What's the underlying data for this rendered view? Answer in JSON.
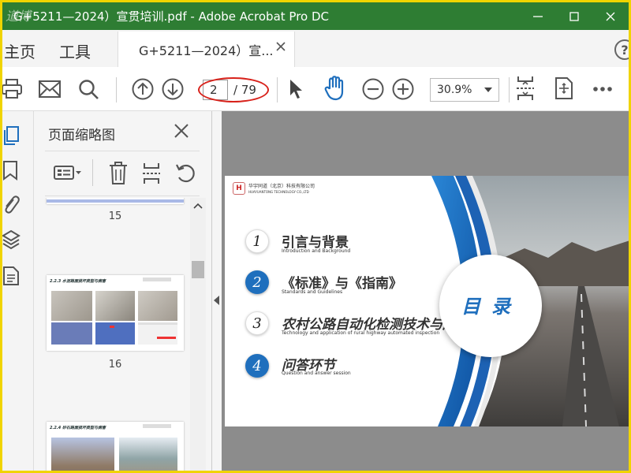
{
  "app": {
    "title": "G+5211—2024）宣贯培训.pdf - Adobe Acrobat Pro DC",
    "watermark": "道博"
  },
  "nav_tabs": {
    "home": "主页",
    "tools": "工具"
  },
  "doc_tab": {
    "label": "G+5211—2024）宣..."
  },
  "help": {
    "label": "?"
  },
  "toolbar": {
    "current_page": "2",
    "total_pages": "/ 79",
    "zoom": "30.9%"
  },
  "thumbnails": {
    "panel_title": "页面缩略图",
    "pages": [
      {
        "number": "15",
        "heading": ""
      },
      {
        "number": "16",
        "heading": "2.2.3 水泥路面损坏类型与病害"
      },
      {
        "number": "",
        "heading": "2.2.4 砂石路面损坏类型与病害"
      }
    ]
  },
  "slide": {
    "company_cn": "华宇同道（北京）科技有限公司",
    "company_en": "HUAYUANTONG TECHNOLOGY CO.,LTD",
    "logo_text": "H",
    "heading": "目录",
    "items": [
      {
        "num": "1",
        "title": "引言与背景",
        "subtitle": "Introduction and Background"
      },
      {
        "num": "2",
        "title": "《标准》与《指南》",
        "subtitle": "Standards and Guidelines"
      },
      {
        "num": "3",
        "title": "农村公路自动化检测技术与应用",
        "subtitle": "Technology and application of rural highway automated inspection"
      },
      {
        "num": "4",
        "title": "问答环节",
        "subtitle": "Question and answer session"
      }
    ]
  },
  "colors": {
    "titlebar": "#2e7d33",
    "accent_blue": "#1f6fbd",
    "highlight_red": "#d8221b",
    "frame_yellow": "#f0d400"
  }
}
